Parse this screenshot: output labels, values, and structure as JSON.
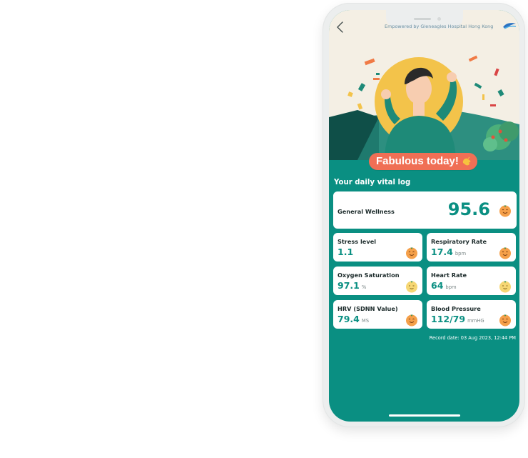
{
  "header": {
    "powered_by": "Empowered by Gleneagles Hospital Hong Kong",
    "back_icon": "chevron-left-icon",
    "logo_icon": "hospital-logo-icon"
  },
  "hero": {
    "mood_title": "Fabulous today!",
    "mood_icon": "waving-hand-icon"
  },
  "vitals": {
    "section_title": "Your daily vital log",
    "general_wellness": {
      "label": "General Wellness",
      "value": "95.6",
      "icon": "orange-happy-face-icon"
    },
    "stress": {
      "label": "Stress level",
      "value": "1.1",
      "unit": "",
      "icon": "orange-happy-face-icon"
    },
    "respiratory": {
      "label": "Respiratory Rate",
      "value": "17.4",
      "unit": "bpm",
      "icon": "orange-happy-face-icon"
    },
    "oxygen": {
      "label": "Oxygen Saturation",
      "value": "97.1",
      "unit": "%",
      "icon": "yellow-smile-face-icon"
    },
    "heart_rate": {
      "label": "Heart Rate",
      "value": "64",
      "unit": "bpm",
      "icon": "yellow-smile-face-icon"
    },
    "hrv": {
      "label": "HRV (SDNN Value)",
      "value": "79.4",
      "unit": "MS",
      "icon": "orange-happy-face-icon"
    },
    "blood_pressure": {
      "label": "Blood Pressure",
      "value": "112/79",
      "unit": "mmHG",
      "icon": "orange-happy-face-icon"
    },
    "record_date": "Record date: 03 Aug 2023, 12:44 PM"
  },
  "colors": {
    "teal": "#0a8f82",
    "coral": "#f06f55",
    "cream": "#f4efe4",
    "sun": "#f3c34a"
  }
}
